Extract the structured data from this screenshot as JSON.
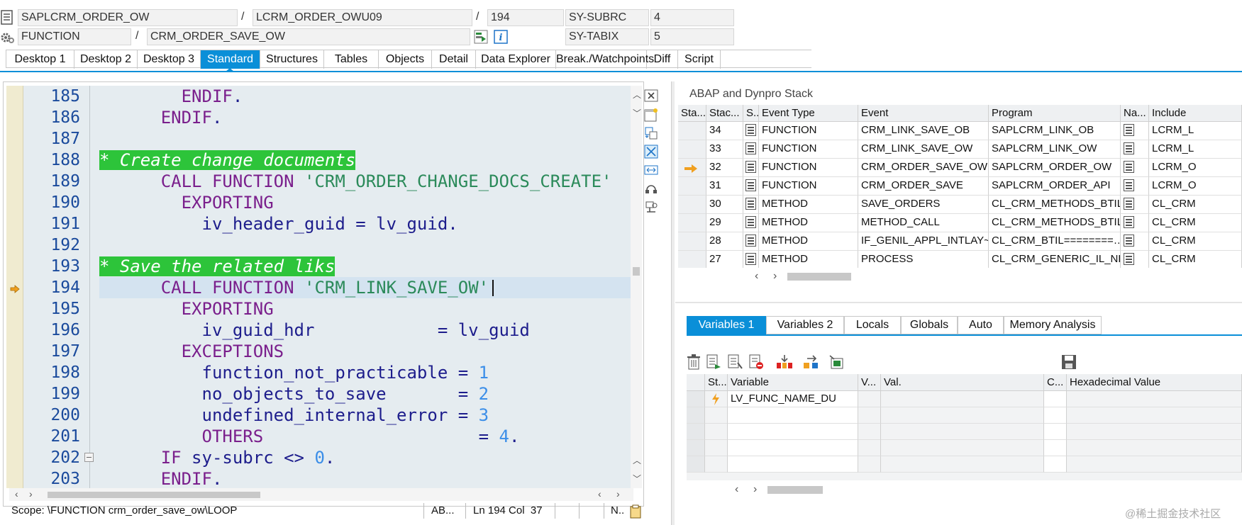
{
  "header": {
    "program": "SAPLCRM_ORDER_OW",
    "include": "LCRM_ORDER_OWU09",
    "line": "194",
    "sy_subrc_label": "SY-SUBRC",
    "sy_subrc_value": "4",
    "event_type": "FUNCTION",
    "event": "CRM_ORDER_SAVE_OW",
    "sy_tabix_label": "SY-TABIX",
    "sy_tabix_value": "5",
    "separator": "/"
  },
  "tabs": [
    {
      "label": "Desktop 1"
    },
    {
      "label": "Desktop 2"
    },
    {
      "label": "Desktop 3"
    },
    {
      "label": "Standard",
      "active": true
    },
    {
      "label": "Structures"
    },
    {
      "label": "Tables"
    },
    {
      "label": "Objects"
    },
    {
      "label": "Detail"
    },
    {
      "label": "Data Explorer"
    },
    {
      "label": "Break./Watchpoints"
    },
    {
      "label": "Diff"
    },
    {
      "label": "Script"
    }
  ],
  "code": {
    "current_line": 194,
    "lines": [
      {
        "no": "185",
        "indent": "        ",
        "parts": [
          {
            "t": "ENDIF",
            "c": "kw"
          },
          {
            "t": ".",
            "c": ""
          }
        ]
      },
      {
        "no": "186",
        "indent": "      ",
        "parts": [
          {
            "t": "ENDIF",
            "c": "kw"
          },
          {
            "t": ".",
            "c": ""
          }
        ]
      },
      {
        "no": "187",
        "indent": "",
        "parts": []
      },
      {
        "no": "188",
        "indent": "",
        "parts": [
          {
            "t": "* Create change documents",
            "c": "cmt"
          }
        ]
      },
      {
        "no": "189",
        "indent": "      ",
        "parts": [
          {
            "t": "CALL FUNCTION",
            "c": "kw"
          },
          {
            "t": " ",
            "c": ""
          },
          {
            "t": "'CRM_ORDER_CHANGE_DOCS_CREATE'",
            "c": "str"
          }
        ]
      },
      {
        "no": "190",
        "indent": "        ",
        "parts": [
          {
            "t": "EXPORTING",
            "c": "kw"
          }
        ]
      },
      {
        "no": "191",
        "indent": "          ",
        "parts": [
          {
            "t": "iv_header_guid = lv_guid.",
            "c": ""
          }
        ]
      },
      {
        "no": "192",
        "indent": "",
        "parts": []
      },
      {
        "no": "193",
        "indent": "",
        "parts": [
          {
            "t": "* Save the related liks",
            "c": "cmt"
          }
        ]
      },
      {
        "no": "194",
        "indent": "      ",
        "parts": [
          {
            "t": "CALL FUNCTION",
            "c": "kw"
          },
          {
            "t": " ",
            "c": ""
          },
          {
            "t": "'CRM_LINK_SAVE_OW'",
            "c": "str"
          }
        ]
      },
      {
        "no": "195",
        "indent": "        ",
        "parts": [
          {
            "t": "EXPORTING",
            "c": "kw"
          }
        ]
      },
      {
        "no": "196",
        "indent": "          ",
        "parts": [
          {
            "t": "iv_guid_hdr            = lv_guid",
            "c": ""
          }
        ]
      },
      {
        "no": "197",
        "indent": "        ",
        "parts": [
          {
            "t": "EXCEPTIONS",
            "c": "kw"
          }
        ]
      },
      {
        "no": "198",
        "indent": "          ",
        "parts": [
          {
            "t": "function_not_practicable = ",
            "c": ""
          },
          {
            "t": "1",
            "c": "num"
          }
        ]
      },
      {
        "no": "199",
        "indent": "          ",
        "parts": [
          {
            "t": "no_objects_to_save       = ",
            "c": ""
          },
          {
            "t": "2",
            "c": "num"
          }
        ]
      },
      {
        "no": "200",
        "indent": "          ",
        "parts": [
          {
            "t": "undefined_internal_error = ",
            "c": ""
          },
          {
            "t": "3",
            "c": "num"
          }
        ]
      },
      {
        "no": "201",
        "indent": "          ",
        "parts": [
          {
            "t": "OTHERS",
            "c": "kw"
          },
          {
            "t": "                     = ",
            "c": ""
          },
          {
            "t": "4",
            "c": "num"
          },
          {
            "t": ".",
            "c": ""
          }
        ]
      },
      {
        "no": "202",
        "indent": "      ",
        "parts": [
          {
            "t": "IF",
            "c": "kw"
          },
          {
            "t": " sy-subrc <> ",
            "c": ""
          },
          {
            "t": "0",
            "c": "num"
          },
          {
            "t": ".",
            "c": ""
          }
        ]
      },
      {
        "no": "203",
        "indent": "      ",
        "parts": [
          {
            "t": "ENDIF",
            "c": "kw"
          },
          {
            "t": ".",
            "c": ""
          }
        ]
      }
    ]
  },
  "statusbar": {
    "scope": "Scope: \\FUNCTION crm_order_save_ow\\LOOP",
    "mode": "AB...",
    "position": "Ln 194 Col  37",
    "ins": "N.."
  },
  "stack": {
    "title": "ABAP and Dynpro Stack",
    "columns": [
      "Sta...",
      "Stac...",
      "S..",
      "Event Type",
      "Event",
      "Program",
      "Na...",
      "Include"
    ],
    "rows": [
      {
        "level": "34",
        "type": "FUNCTION",
        "event": "CRM_LINK_SAVE_OB",
        "program": "SAPLCRM_LINK_OB",
        "include": "LCRM_L",
        "current": false
      },
      {
        "level": "33",
        "type": "FUNCTION",
        "event": "CRM_LINK_SAVE_OW",
        "program": "SAPLCRM_LINK_OW",
        "include": "LCRM_L",
        "current": false
      },
      {
        "level": "32",
        "type": "FUNCTION",
        "event": "CRM_ORDER_SAVE_OW",
        "program": "SAPLCRM_ORDER_OW",
        "include": "LCRM_O",
        "current": true
      },
      {
        "level": "31",
        "type": "FUNCTION",
        "event": "CRM_ORDER_SAVE",
        "program": "SAPLCRM_ORDER_API",
        "include": "LCRM_O",
        "current": false
      },
      {
        "level": "30",
        "type": "METHOD",
        "event": "SAVE_ORDERS",
        "program": "CL_CRM_METHODS_BTIL=…",
        "include": "CL_CRM",
        "current": false
      },
      {
        "level": "29",
        "type": "METHOD",
        "event": "METHOD_CALL",
        "program": "CL_CRM_METHODS_BTIL=…",
        "include": "CL_CRM",
        "current": false
      },
      {
        "level": "28",
        "type": "METHOD",
        "event": "IF_GENIL_APPL_INTLAY~…",
        "program": "CL_CRM_BTIL========…",
        "include": "CL_CRM",
        "current": false
      },
      {
        "level": "27",
        "type": "METHOD",
        "event": "PROCESS",
        "program": "CL_CRM_GENERIC_IL_NE…",
        "include": "CL_CRM",
        "current": false
      }
    ]
  },
  "variables": {
    "tabs": [
      {
        "label": "Variables 1",
        "active": true
      },
      {
        "label": "Variables 2"
      },
      {
        "label": "Locals"
      },
      {
        "label": "Globals"
      },
      {
        "label": "Auto"
      },
      {
        "label": "Memory Analysis"
      }
    ],
    "columns": [
      "St...",
      "Variable",
      "V...",
      "Val.",
      "C...",
      "Hexadecimal Value"
    ],
    "rows": [
      {
        "name": "LV_FUNC_NAME_DU",
        "value": "",
        "hex": ""
      }
    ]
  },
  "watermark": "@稀土掘金技术社区",
  "colors": {
    "accent": "#0a8fd8",
    "comment_bg": "#2dc43a",
    "keyword": "#7a1f8c",
    "string": "#2b8a5a",
    "number": "#3b8ee8",
    "identifier": "#1d1d8c",
    "editor_bg": "#e5ecf0",
    "current_line_bg": "#d4e3f0",
    "arrow": "#f0a020"
  },
  "icons": [
    "document-icon",
    "gear-icon",
    "step-icon",
    "info-icon",
    "trash-icon",
    "arrow-right-icon",
    "save-icon",
    "bolt-icon"
  ]
}
